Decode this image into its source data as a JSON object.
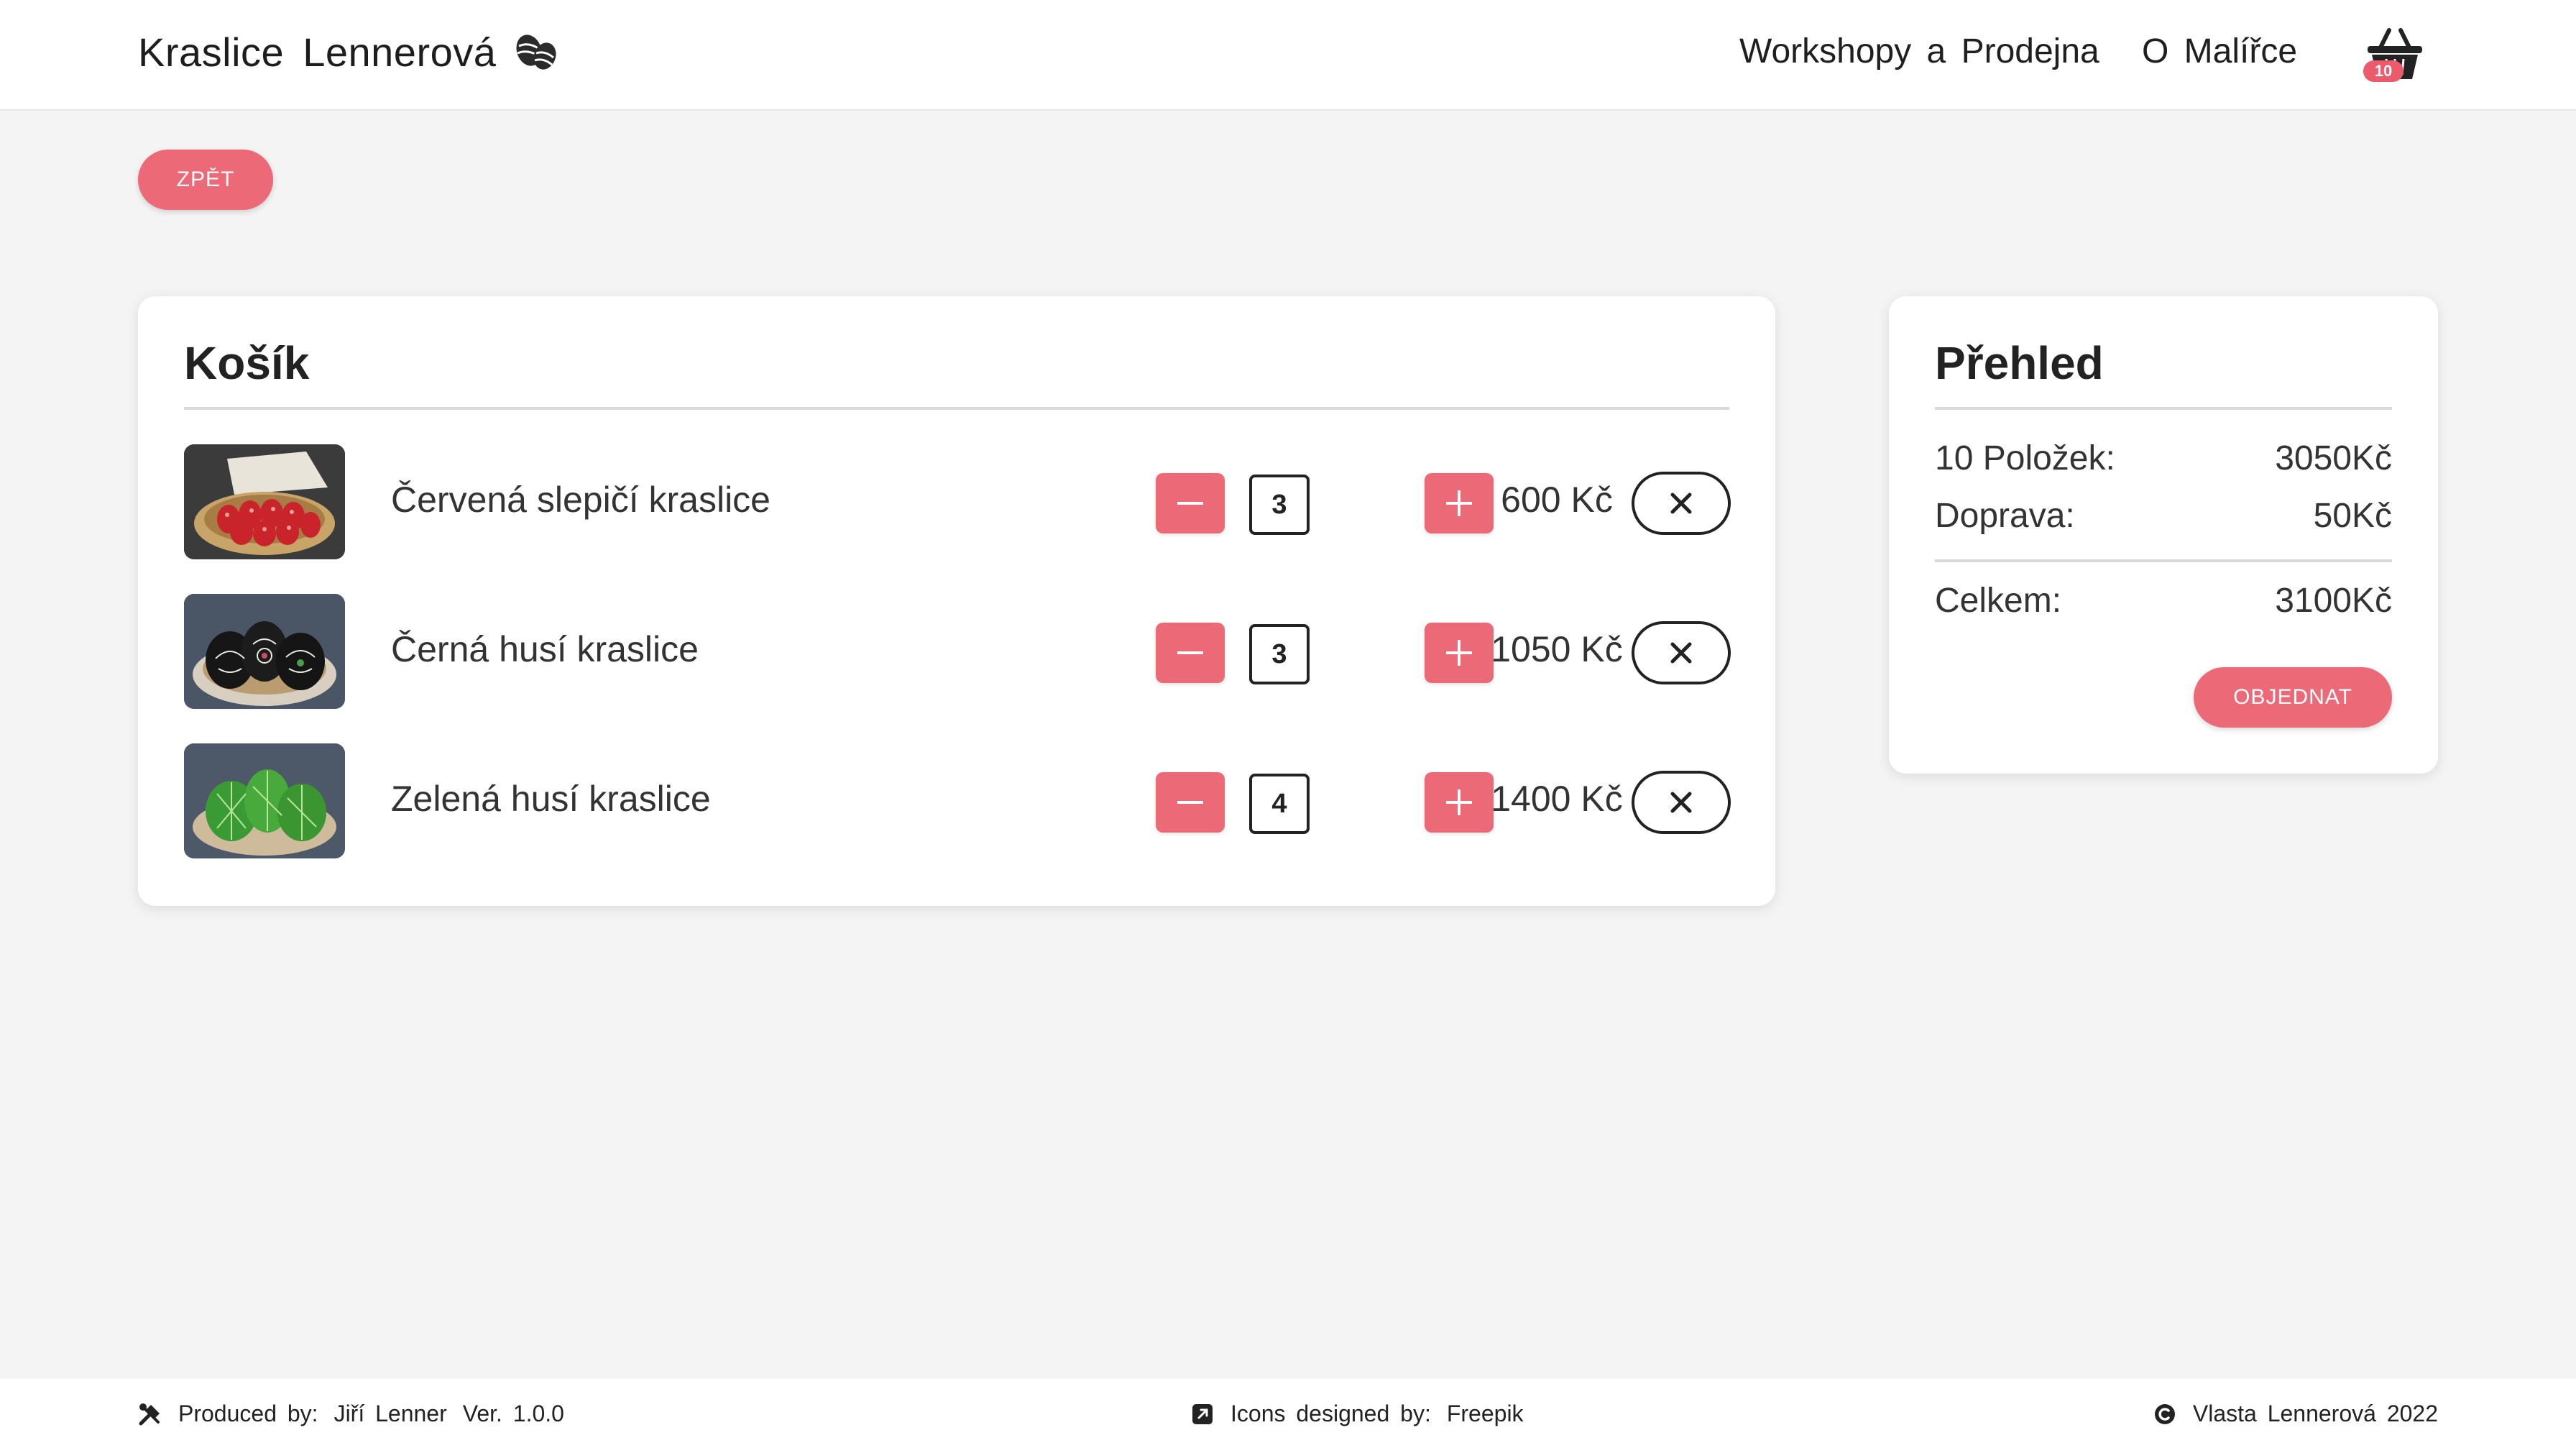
{
  "header": {
    "brand": "Kraslice Lennerová",
    "nav": {
      "workshops": "Workshopy a Prodejna",
      "about": "O Malířce"
    },
    "cart_count": "10"
  },
  "back_label": "ZPĚT",
  "cart": {
    "title": "Košík",
    "items": [
      {
        "name": "Červená slepičí kraslice",
        "qty": "3",
        "price": "600 Kč"
      },
      {
        "name": "Černá husí kraslice",
        "qty": "3",
        "price": "1050 Kč"
      },
      {
        "name": "Zelená husí kraslice",
        "qty": "4",
        "price": "1400 Kč"
      }
    ]
  },
  "summary": {
    "title": "Přehled",
    "items_label": "10 Položek:",
    "items_value": "3050Kč",
    "shipping_label": "Doprava:",
    "shipping_value": "50Kč",
    "total_label": "Celkem:",
    "total_value": "3100Kč",
    "order_label": "OBJEDNAT"
  },
  "footer": {
    "produced_by_label": "Produced by:",
    "produced_by_name": "Jiří Lenner",
    "version": "Ver. 1.0.0",
    "icons_label": "Icons designed by:",
    "icons_author": "Freepik",
    "copyright": "Vlasta Lennerová 2022"
  },
  "colors": {
    "accent": "#ec6a77",
    "badge": "#ec5b6b",
    "background": "#f4f4f4",
    "card": "#ffffff"
  },
  "icons": {
    "brand": "easter-eggs-icon",
    "cart": "basket-icon",
    "remove": "close-icon",
    "footer_left": "tools-icon",
    "footer_mid": "external-link-icon",
    "footer_right": "copyright-icon"
  }
}
